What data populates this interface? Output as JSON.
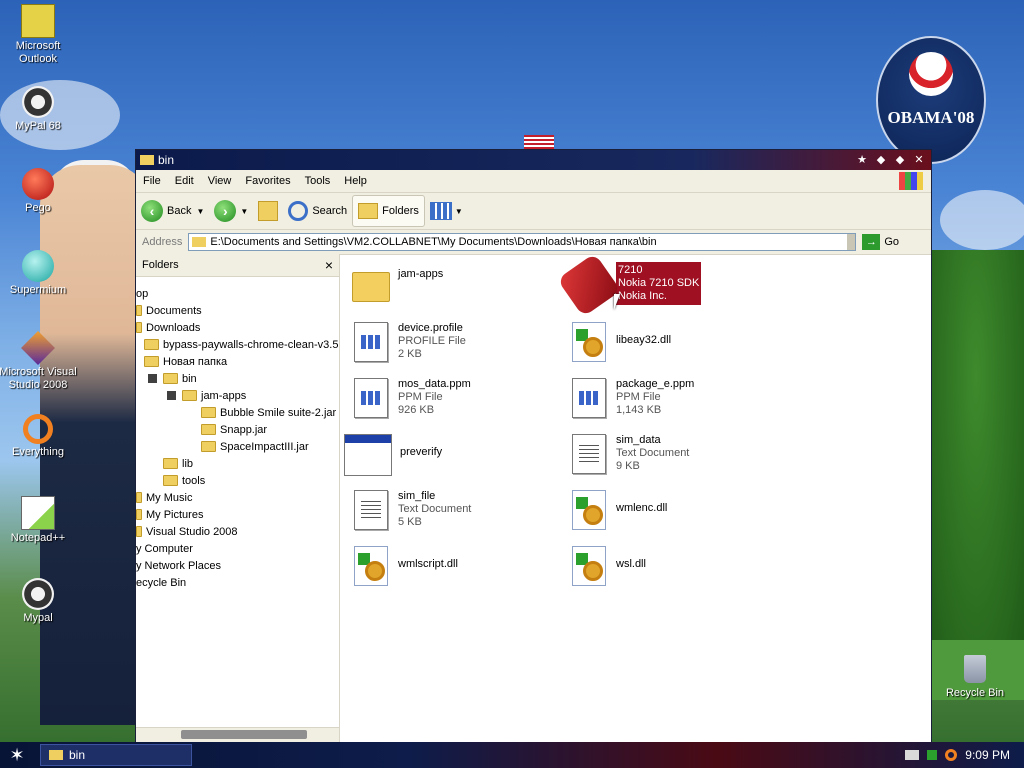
{
  "desktop": {
    "icons": [
      {
        "label": "Microsoft Outlook",
        "icon": "outlook-icon"
      },
      {
        "label": "MyPal 68",
        "icon": "raccoon-icon"
      },
      {
        "label": "Pego",
        "icon": "pego-icon"
      },
      {
        "label": "Supermium",
        "icon": "supermium-icon"
      },
      {
        "label": "Microsoft Visual Studio 2008",
        "icon": "visual-studio-icon"
      },
      {
        "label": "Everything",
        "icon": "search-ring-icon"
      },
      {
        "label": "Notepad++",
        "icon": "notepadpp-icon"
      },
      {
        "label": "Mypal",
        "icon": "raccoon-icon"
      }
    ],
    "recycle_bin": "Recycle Bin",
    "badge_text": "OBAMA'08"
  },
  "window": {
    "title": "bin",
    "menu": [
      "File",
      "Edit",
      "View",
      "Favorites",
      "Tools",
      "Help"
    ],
    "toolbar": {
      "back": "Back",
      "search": "Search",
      "folders": "Folders"
    },
    "address": {
      "label": "Address",
      "value": "E:\\Documents and Settings\\VM2.COLLABNET\\My Documents\\Downloads\\Новая папка\\bin",
      "go": "Go"
    },
    "folders_pane": {
      "title": "Folders",
      "items": [
        "op",
        "Documents",
        "Downloads",
        "bypass-paywalls-chrome-clean-v3.5",
        "Новая папка",
        "bin",
        "jam-apps",
        "Bubble Smile suite-2.jar",
        "Snapp.jar",
        "SpaceImpactIII.jar",
        "lib",
        "tools",
        "My Music",
        "My Pictures",
        "Visual Studio 2008",
        "y Computer",
        "y Network Places",
        "ecycle Bin"
      ]
    },
    "files": [
      {
        "name": "jam-apps",
        "type": "",
        "size": ""
      },
      {
        "name": "7210",
        "type": "Nokia 7210 SDK",
        "size": "Nokia Inc."
      },
      {
        "name": "device.profile",
        "type": "PROFILE File",
        "size": "2 KB"
      },
      {
        "name": "libeay32.dll",
        "type": "",
        "size": ""
      },
      {
        "name": "mos_data.ppm",
        "type": "PPM File",
        "size": "926 KB"
      },
      {
        "name": "package_e.ppm",
        "type": "PPM File",
        "size": "1,143 KB"
      },
      {
        "name": "preverify",
        "type": "",
        "size": ""
      },
      {
        "name": "sim_data",
        "type": "Text Document",
        "size": "9 KB"
      },
      {
        "name": "sim_file",
        "type": "Text Document",
        "size": "5 KB"
      },
      {
        "name": "wmlenc.dll",
        "type": "",
        "size": ""
      },
      {
        "name": "wmlscript.dll",
        "type": "",
        "size": ""
      },
      {
        "name": "wsl.dll",
        "type": "",
        "size": ""
      }
    ]
  },
  "taskbar": {
    "task_label": "bin",
    "clock": "9:09 PM"
  },
  "colors": {
    "selection": "#9e1022",
    "window_frame": "#0b1a4a"
  }
}
